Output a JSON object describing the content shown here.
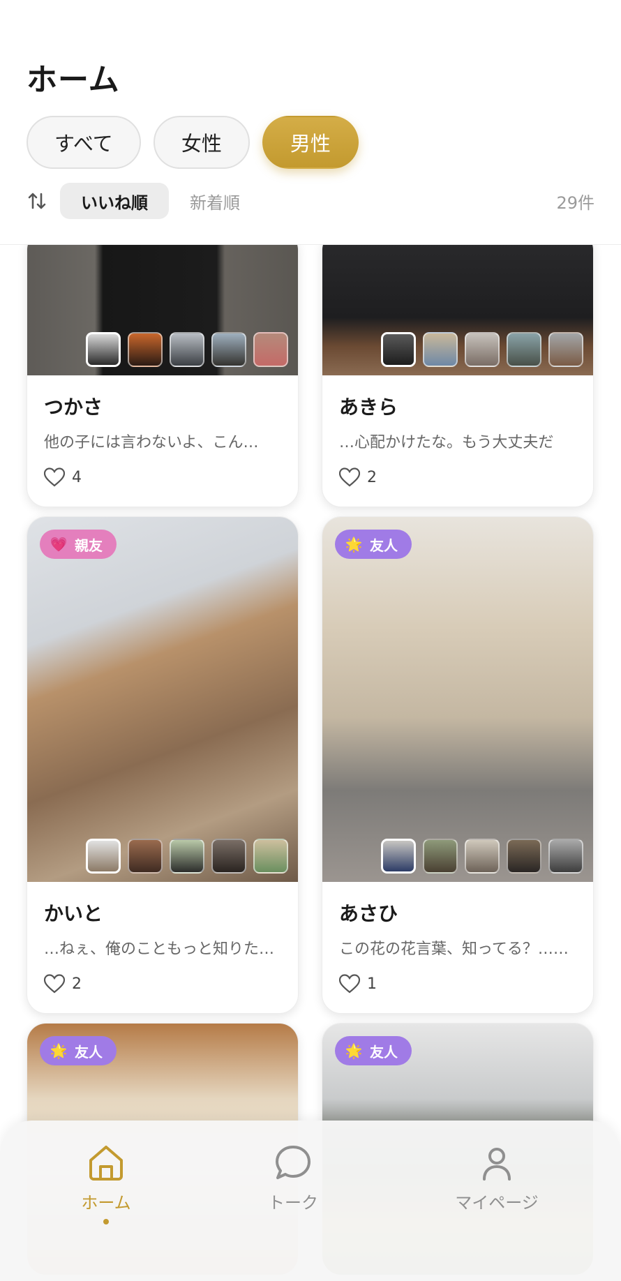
{
  "header": {
    "title": "ホーム",
    "filters": [
      "すべて",
      "女性",
      "男性"
    ],
    "sort_options": [
      "いいね順",
      "新着順"
    ],
    "count": "29件"
  },
  "cards": [
    {
      "name": "つかさ",
      "quote": "他の子には言わないよ、こん…",
      "likes": "4"
    },
    {
      "name": "あきら",
      "quote": "…心配かけたな。もう大丈夫だ",
      "likes": "2"
    },
    {
      "name": "かいと",
      "quote": "…ねぇ、俺のこともっと知りた…",
      "likes": "2",
      "badge": "親友"
    },
    {
      "name": "あさひ",
      "quote": "この花の花言葉、知ってる？……",
      "likes": "1",
      "badge": "友人"
    },
    {
      "badge": "友人"
    },
    {
      "badge": "友人"
    }
  ],
  "nav": {
    "home": "ホーム",
    "talk": "トーク",
    "mypage": "マイページ"
  },
  "colors": {
    "accent": "#c39a2f",
    "badge_best_friend": "#e47fbd",
    "badge_friend": "#a07be6"
  }
}
